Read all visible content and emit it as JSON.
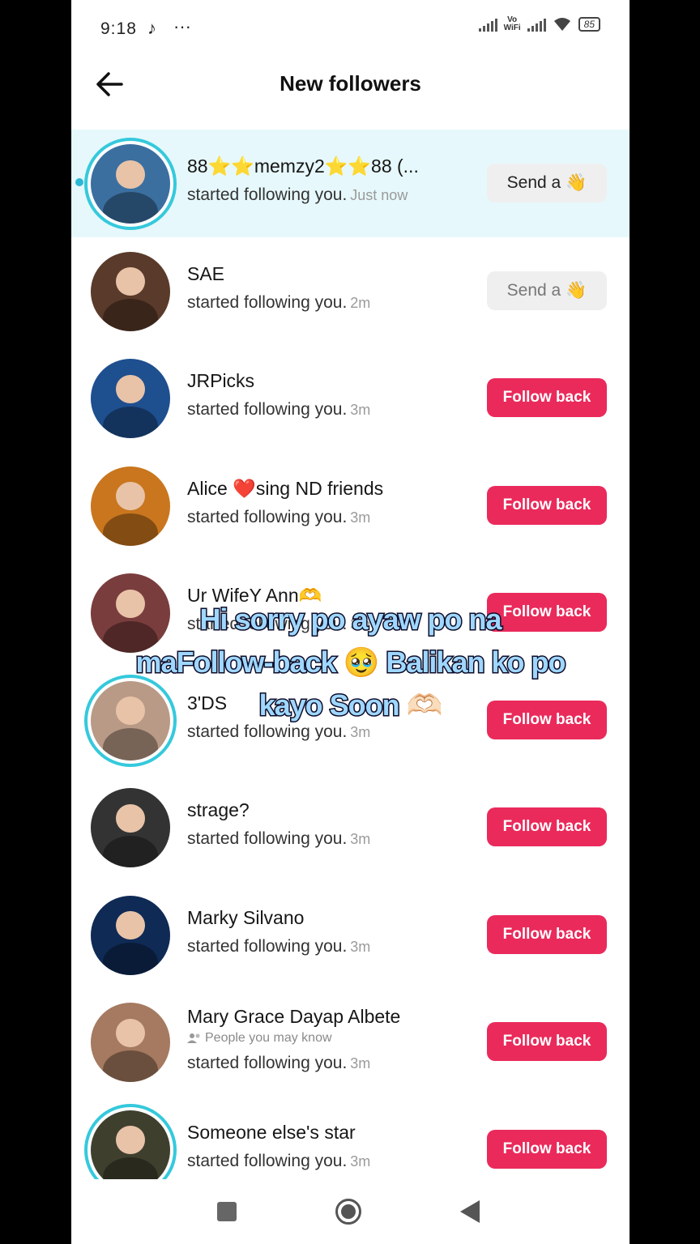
{
  "status_bar": {
    "time": "9:18",
    "battery": "85",
    "volte_label": "Vo\nWiFi"
  },
  "header": {
    "title": "New followers"
  },
  "followers": [
    {
      "name": "88⭐⭐memzy2⭐⭐88 (...",
      "subtext": "",
      "message": "started following you.",
      "time": "Just now",
      "button": "Send a",
      "button_emoji": "👋",
      "button_type": "send",
      "story_ring": true,
      "highlighted": true,
      "avatar_color": "#3b6fa0"
    },
    {
      "name": "SAE",
      "subtext": "",
      "message": "started following you.",
      "time": "2m",
      "button": "Send a",
      "button_emoji": "👋",
      "button_type": "send-faded",
      "story_ring": false,
      "highlighted": false,
      "avatar_color": "#5a3a2a"
    },
    {
      "name": "JRPicks",
      "subtext": "",
      "message": "started following you.",
      "time": "3m",
      "button": "Follow back",
      "button_emoji": "",
      "button_type": "follow",
      "story_ring": false,
      "highlighted": false,
      "avatar_color": "#1e4f8f"
    },
    {
      "name": "Alice ❤️sing ND friends",
      "subtext": "",
      "message": "started following you.",
      "time": "3m",
      "button": "Follow back",
      "button_emoji": "",
      "button_type": "follow",
      "story_ring": false,
      "highlighted": false,
      "avatar_color": "#c9761e"
    },
    {
      "name": "Ur WifeY Ann🫶",
      "subtext": "",
      "message": "started following you.",
      "time": "3m",
      "button": "Follow back",
      "button_emoji": "",
      "button_type": "follow",
      "story_ring": false,
      "highlighted": false,
      "avatar_color": "#7a3d3d"
    },
    {
      "name": "3'DS",
      "subtext": "",
      "message": "started following you.",
      "time": "3m",
      "button": "Follow back",
      "button_emoji": "",
      "button_type": "follow",
      "story_ring": true,
      "highlighted": false,
      "avatar_color": "#b99a86"
    },
    {
      "name": "strage?",
      "subtext": "",
      "message": "started following you.",
      "time": "3m",
      "button": "Follow back",
      "button_emoji": "",
      "button_type": "follow",
      "story_ring": false,
      "highlighted": false,
      "avatar_color": "#333333"
    },
    {
      "name": "Marky Silvano",
      "subtext": "",
      "message": "started following you.",
      "time": "3m",
      "button": "Follow back",
      "button_emoji": "",
      "button_type": "follow",
      "story_ring": false,
      "highlighted": false,
      "avatar_color": "#0f2a55"
    },
    {
      "name": "Mary Grace Dayap Albete",
      "subtext": "People you may know",
      "message": "started following you.",
      "time": "3m",
      "button": "Follow back",
      "button_emoji": "",
      "button_type": "follow",
      "story_ring": false,
      "highlighted": false,
      "avatar_color": "#a57a60"
    },
    {
      "name": "Someone else's star",
      "subtext": "",
      "message": "started following you.",
      "time": "3m",
      "button": "Follow back",
      "button_emoji": "",
      "button_type": "follow",
      "story_ring": true,
      "highlighted": false,
      "avatar_color": "#3f3f2e"
    }
  ],
  "caption": {
    "line1": "Hi sorry po ayaw po na",
    "line2": "maFollow-back 🥹  Balikan ko po",
    "line3": "kayo Soon 🫶🏻"
  },
  "colors": {
    "accent": "#ea2a5b",
    "story_ring": "#35c9dc",
    "highlight_bg": "#e6f8fb"
  }
}
